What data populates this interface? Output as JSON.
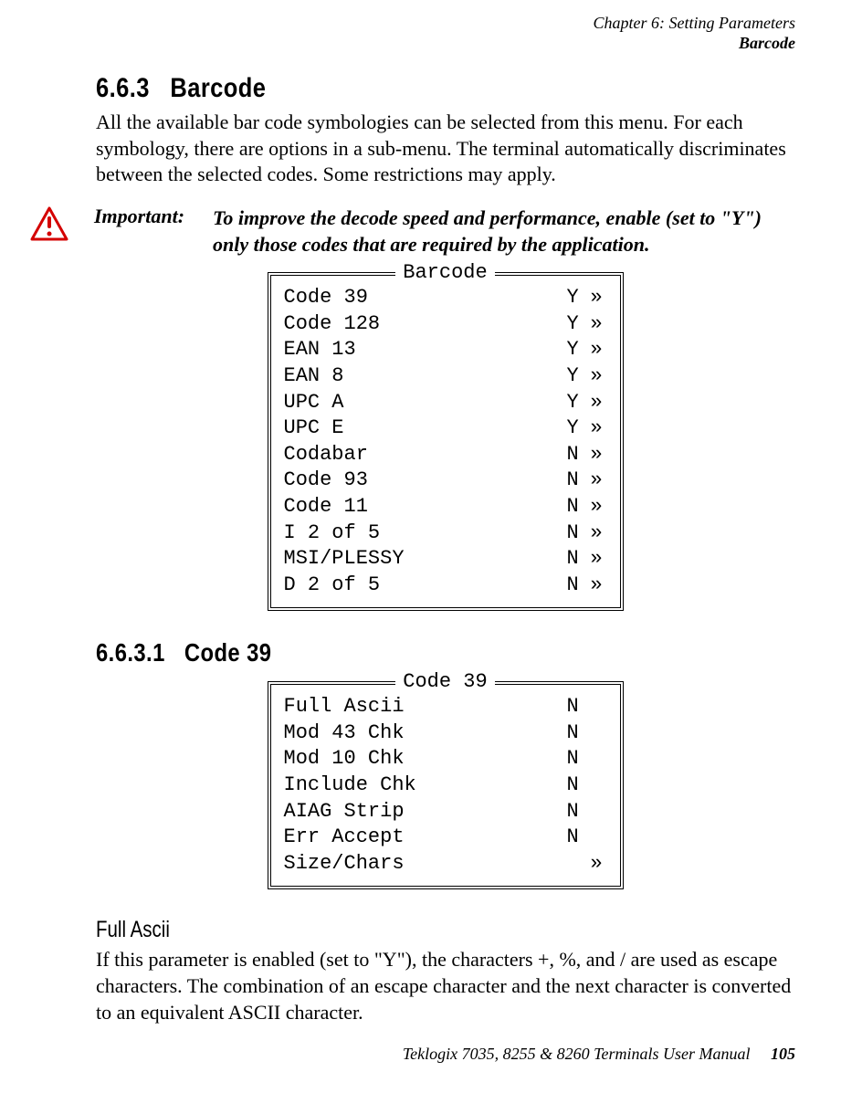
{
  "header": {
    "chapter": "Chapter  6:  Setting Parameters",
    "section": "Barcode"
  },
  "sec1": {
    "num": "6.6.3",
    "title": "Barcode",
    "para": "All the available bar code symbologies can be selected from this menu. For each symbology, there are options in a sub-menu. The terminal automatically discriminates between the selected codes. Some restrictions may apply."
  },
  "important": {
    "label": "Important:",
    "text": "To improve the decode speed and performance, enable (set to \"Y\") only those codes that are required by the application."
  },
  "barcodeMenu": {
    "title": "Barcode",
    "items": [
      {
        "label": "Code 39",
        "val": "Y",
        "sub": "»"
      },
      {
        "label": "Code 128",
        "val": "Y",
        "sub": "»"
      },
      {
        "label": "EAN 13",
        "val": "Y",
        "sub": "»"
      },
      {
        "label": "EAN 8",
        "val": "Y",
        "sub": "»"
      },
      {
        "label": "UPC A",
        "val": "Y",
        "sub": "»"
      },
      {
        "label": "UPC E",
        "val": "Y",
        "sub": "»"
      },
      {
        "label": "Codabar",
        "val": "N",
        "sub": "»"
      },
      {
        "label": "Code 93",
        "val": "N",
        "sub": "»"
      },
      {
        "label": "Code 11",
        "val": "N",
        "sub": "»"
      },
      {
        "label": "I 2 of 5",
        "val": "N",
        "sub": "»"
      },
      {
        "label": "MSI/PLESSY",
        "val": "N",
        "sub": "»"
      },
      {
        "label": "D 2 of 5",
        "val": "N",
        "sub": "»"
      }
    ]
  },
  "sec2": {
    "num": "6.6.3.1",
    "title": "Code 39"
  },
  "code39Menu": {
    "title": "Code 39",
    "items": [
      {
        "label": "Full Ascii",
        "val": "N",
        "sub": ""
      },
      {
        "label": "Mod 43 Chk",
        "val": "N",
        "sub": ""
      },
      {
        "label": "Mod 10 Chk",
        "val": "N",
        "sub": ""
      },
      {
        "label": "Include Chk",
        "val": "N",
        "sub": ""
      },
      {
        "label": "AIAG Strip",
        "val": "N",
        "sub": ""
      },
      {
        "label": "Err Accept",
        "val": "N",
        "sub": ""
      },
      {
        "label": "Size/Chars",
        "val": "",
        "sub": "»"
      }
    ]
  },
  "fullascii": {
    "title": "Full Ascii",
    "para": "If this parameter is enabled (set to \"Y\"), the characters +, %, and / are used as escape characters. The combination of an escape character and the next character is converted to an equivalent ASCII character."
  },
  "footer": {
    "text": "Teklogix 7035, 8255 & 8260 Terminals User Manual",
    "page": "105"
  }
}
